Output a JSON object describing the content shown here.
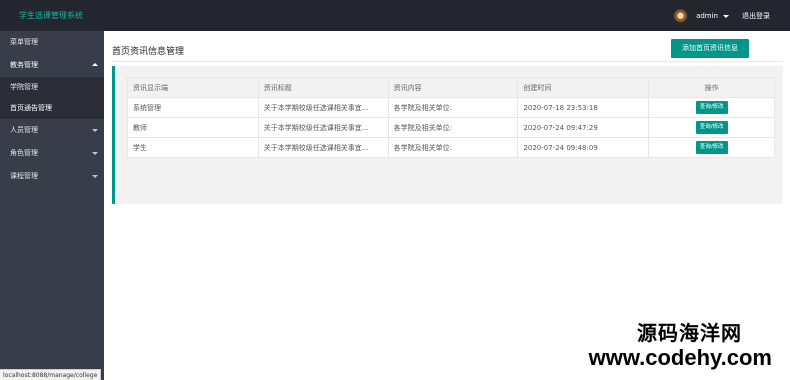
{
  "app": {
    "title": "学生选课管理系统"
  },
  "header": {
    "username": "admin",
    "logout_label": "退出登录"
  },
  "sidebar": {
    "items": [
      {
        "label": "菜单管理"
      },
      {
        "label": "教务管理",
        "expanded": true,
        "children": [
          {
            "label": "学院管理"
          },
          {
            "label": "首页通告管理"
          }
        ]
      },
      {
        "label": "人员管理"
      },
      {
        "label": "角色管理"
      },
      {
        "label": "课程管理"
      }
    ]
  },
  "main": {
    "page_title": "首页资讯信息管理",
    "add_button_label": "添加首页资讯信息",
    "table": {
      "columns": [
        "资讯显示端",
        "资讯标题",
        "资讯内容",
        "创建时间",
        "操作"
      ],
      "rows": [
        {
          "display": "系统管理",
          "title": "关于本学期校级任选课相关事宜...",
          "content": "各学院及相关单位:",
          "created": "2020-07-18 23:53:18",
          "action": "查询/修改"
        },
        {
          "display": "教师",
          "title": "关于本学期校级任选课相关事宜...",
          "content": "各学院及相关单位:",
          "created": "2020-07-24 09:47:29",
          "action": "查询/修改"
        },
        {
          "display": "学生",
          "title": "关于本学期校级任选课相关事宜...",
          "content": "各学院及相关单位:",
          "created": "2020-07-24 09:48:09",
          "action": "查询/修改"
        }
      ]
    }
  },
  "status_bar": {
    "url": "localhost:8088/manage/college"
  },
  "watermark": {
    "text": "源码海洋网",
    "url": "www.codehy.com"
  },
  "colors": {
    "accent": "#009688",
    "topbar": "#23262e",
    "sidebar": "#393d49",
    "title_text": "#1fb5a5"
  }
}
